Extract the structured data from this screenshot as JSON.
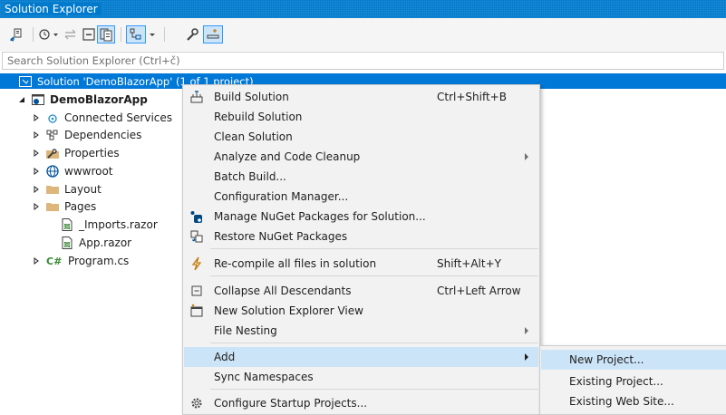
{
  "window": {
    "title": "Solution Explorer"
  },
  "search": {
    "placeholder": "Search Solution Explorer (Ctrl+č)"
  },
  "tree": {
    "solution": "Solution 'DemoBlazorApp' (1 of 1 project)",
    "project": "DemoBlazorApp",
    "items": [
      {
        "label": "Connected Services",
        "icon": "connected-services-icon"
      },
      {
        "label": "Dependencies",
        "icon": "dependencies-icon"
      },
      {
        "label": "Properties",
        "icon": "wrench-folder-icon"
      },
      {
        "label": "wwwroot",
        "icon": "globe-icon"
      },
      {
        "label": "Layout",
        "icon": "folder-icon"
      },
      {
        "label": "Pages",
        "icon": "folder-icon"
      },
      {
        "label": "_Imports.razor",
        "icon": "razor-file-icon"
      },
      {
        "label": "App.razor",
        "icon": "razor-file-icon"
      },
      {
        "label": "Program.cs",
        "icon": "csharp-file-icon"
      }
    ]
  },
  "context_menu": {
    "items": [
      {
        "label": "Build Solution",
        "shortcut": "Ctrl+Shift+B",
        "icon": "build-icon"
      },
      {
        "label": "Rebuild Solution",
        "shortcut": ""
      },
      {
        "label": "Clean Solution",
        "shortcut": ""
      },
      {
        "label": "Analyze and Code Cleanup",
        "shortcut": ""
      },
      {
        "label": "Batch Build...",
        "shortcut": ""
      },
      {
        "label": "Configuration Manager...",
        "shortcut": ""
      },
      {
        "label": "Manage NuGet Packages for Solution...",
        "shortcut": "",
        "icon": "nuget-icon"
      },
      {
        "label": "Restore NuGet Packages",
        "shortcut": "",
        "icon": "restore-packages-icon"
      },
      {
        "label": "Re-compile all files in solution",
        "shortcut": "Shift+Alt+Y",
        "icon": "lightning-icon"
      },
      {
        "label": "Collapse All Descendants",
        "shortcut": "Ctrl+Left Arrow",
        "icon": "collapse-icon"
      },
      {
        "label": "New Solution Explorer View",
        "shortcut": "",
        "icon": "new-view-icon"
      },
      {
        "label": "File Nesting",
        "shortcut": ""
      },
      {
        "label": "Add",
        "shortcut": ""
      },
      {
        "label": "Sync Namespaces",
        "shortcut": ""
      },
      {
        "label": "Configure Startup Projects...",
        "shortcut": "",
        "icon": "gear-icon"
      }
    ]
  },
  "add_submenu": {
    "items": [
      {
        "label": "New Project..."
      },
      {
        "label": "Existing Project..."
      },
      {
        "label": "Existing Web Site..."
      }
    ]
  },
  "colors": {
    "accent": "#007acc",
    "selection": "#0078d7",
    "menu_highlight": "#cce4f7",
    "menu_bg": "#f2f2f2"
  }
}
